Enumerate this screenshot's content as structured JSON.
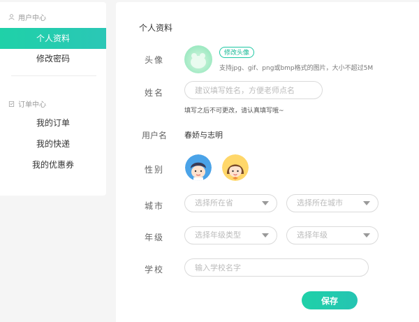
{
  "sidebar": {
    "user_center": {
      "title": "用户中心",
      "icon": "user-icon"
    },
    "items_user": [
      {
        "label": "个人资料",
        "active": true
      },
      {
        "label": "修改密码",
        "active": false
      }
    ],
    "order_center": {
      "title": "订单中心",
      "icon": "clipboard-icon"
    },
    "items_order": [
      {
        "label": "我的订单"
      },
      {
        "label": "我的快递"
      },
      {
        "label": "我的优惠券"
      }
    ]
  },
  "main": {
    "title": "个人资料",
    "avatar": {
      "label": "头像",
      "button": "修改头像",
      "hint": "支持jpg、gif、png或bmp格式的图片，大小不超过5M"
    },
    "name": {
      "label": "姓名",
      "placeholder": "建议填写姓名，方便老师点名",
      "hint": "填写之后不可更改，请认真填写哦~"
    },
    "username": {
      "label": "用户名",
      "value": "春娇与志明"
    },
    "gender": {
      "label": "性别",
      "options": [
        "boy-avatar",
        "girl-avatar"
      ]
    },
    "city": {
      "label": "城市",
      "province_placeholder": "选择所在省",
      "city_placeholder": "选择所在城市"
    },
    "grade": {
      "label": "年级",
      "type_placeholder": "选择年级类型",
      "grade_placeholder": "选择年级"
    },
    "school": {
      "label": "学校",
      "placeholder": "输入学校名字"
    },
    "save": "保存"
  },
  "colors": {
    "accent": "#1fd1a8",
    "accent_text": "#16b894"
  }
}
